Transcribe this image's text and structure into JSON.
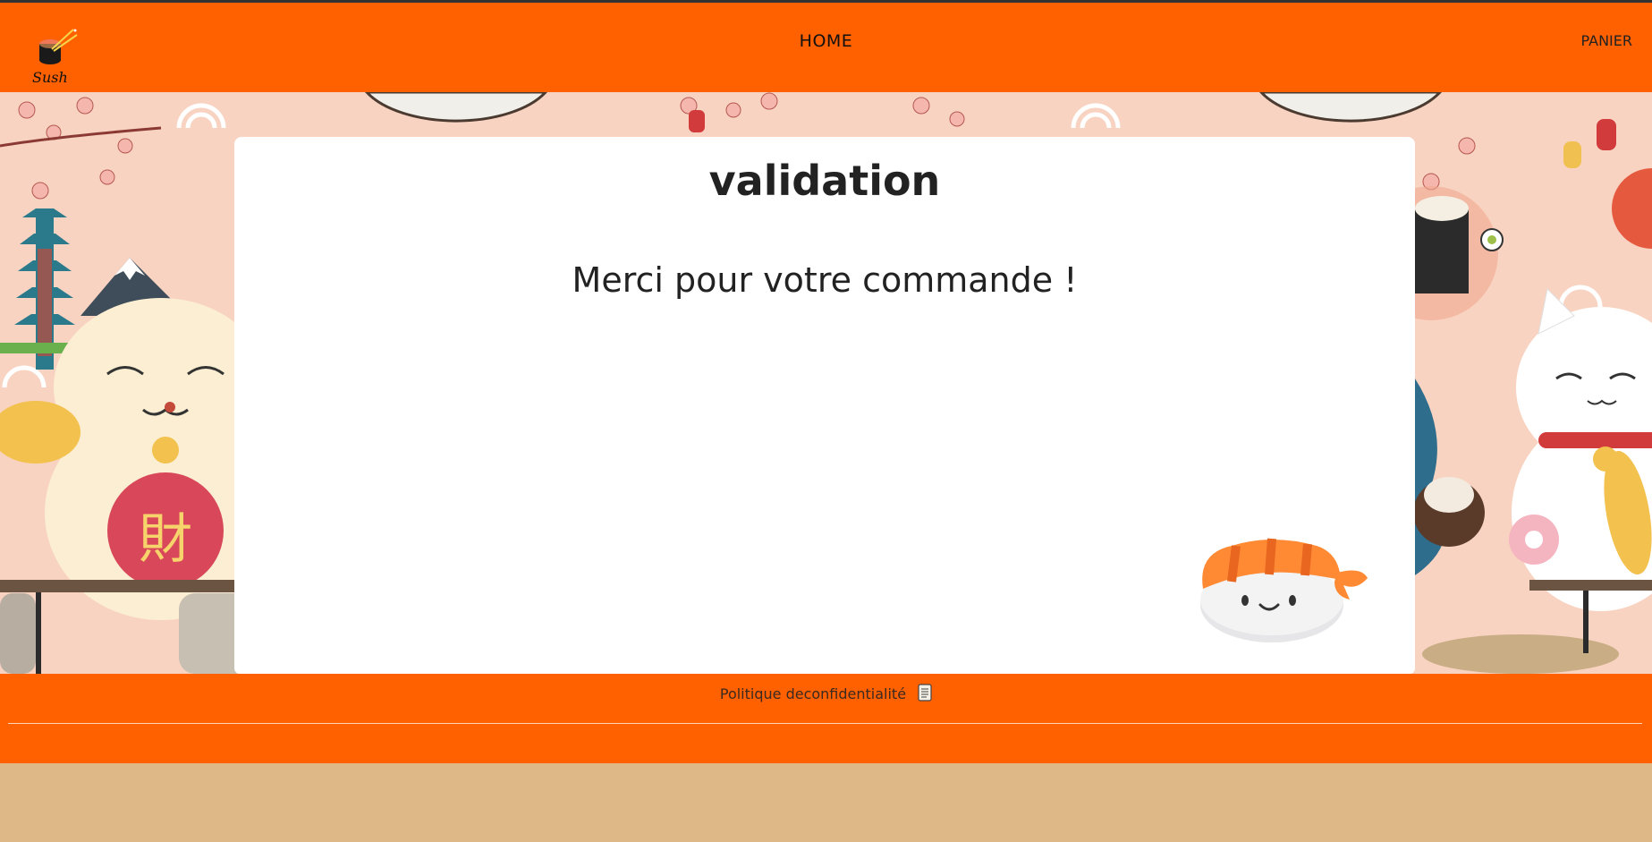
{
  "header": {
    "logo_text": "Sush",
    "nav_home": "HOME",
    "nav_cart": "PANIER"
  },
  "card": {
    "title": "validation",
    "message": "Merci pour votre commande !"
  },
  "footer": {
    "privacy_link": "Politique deconfidentialité",
    "privacy_icon": "scroll-document-icon"
  },
  "colors": {
    "brand_orange": "#ff6000",
    "page_background": "#dfb887",
    "hero_pink": "#f9d3c1"
  }
}
